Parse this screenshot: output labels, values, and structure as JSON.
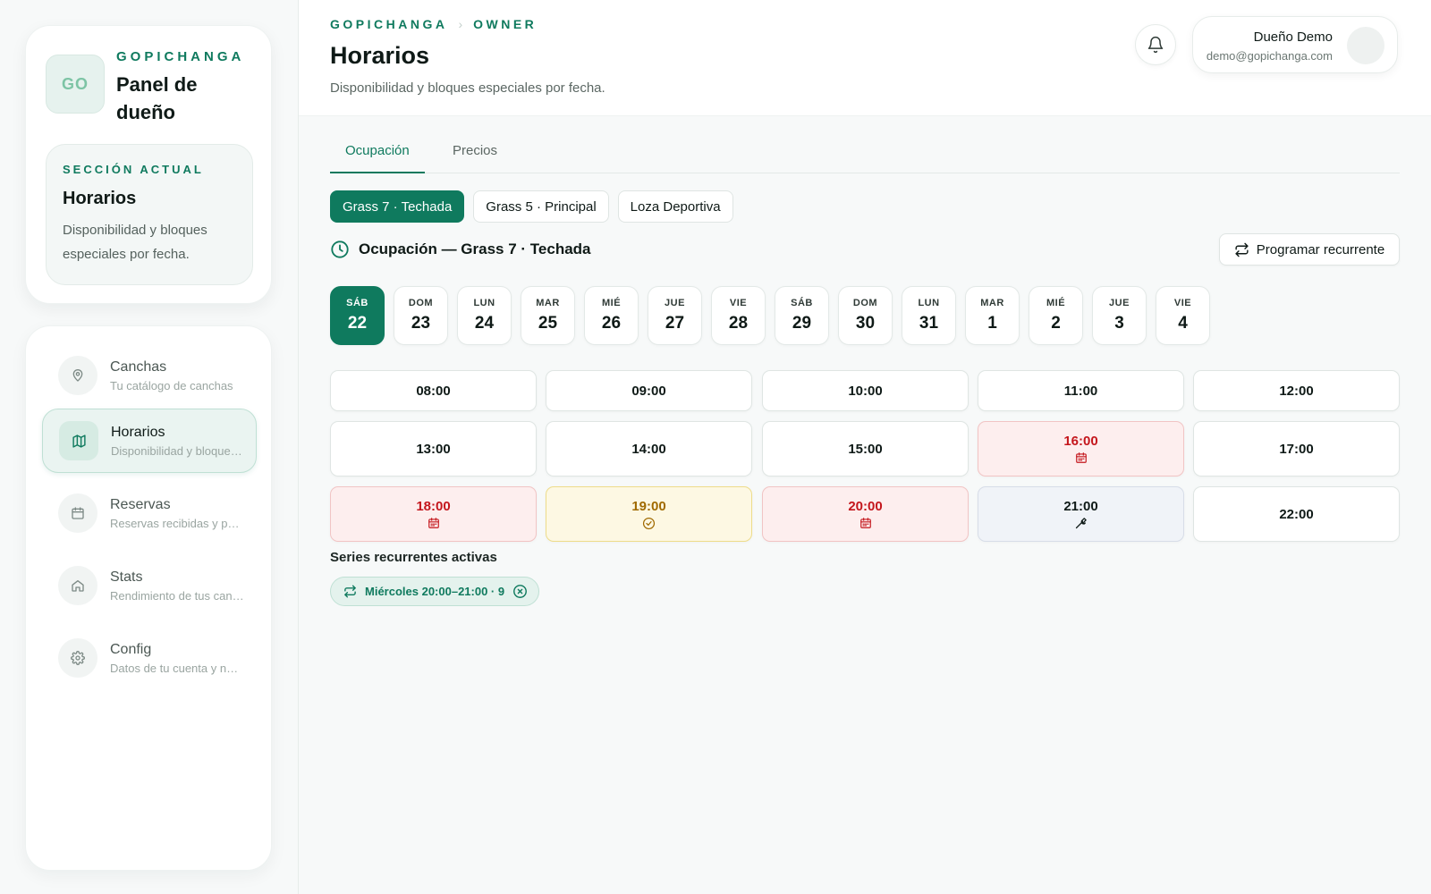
{
  "brand": {
    "logo_text": "GO",
    "eyebrow": "GOPICHANGA",
    "title": "Panel de dueño"
  },
  "current_section": {
    "eyebrow": "SECCIÓN ACTUAL",
    "title": "Horarios",
    "description": "Disponibilidad y bloques especiales por fecha."
  },
  "sidebar": {
    "items": [
      {
        "label": "Canchas",
        "sub": "Tu catálogo de canchas",
        "icon": "map-pin-icon",
        "active": false
      },
      {
        "label": "Horarios",
        "sub": "Disponibilidad y bloques especiales",
        "icon": "map-icon",
        "active": true
      },
      {
        "label": "Reservas",
        "sub": "Reservas recibidas y pendientes",
        "icon": "calendar-icon",
        "active": false
      },
      {
        "label": "Stats",
        "sub": "Rendimiento de tus canchas",
        "icon": "home-icon",
        "active": false
      },
      {
        "label": "Config",
        "sub": "Datos de tu cuenta y negocio",
        "icon": "gear-icon",
        "active": false
      }
    ]
  },
  "header": {
    "breadcrumb": [
      "GOPICHANGA",
      "OWNER"
    ],
    "title": "Horarios",
    "subtitle": "Disponibilidad y bloques especiales por fecha.",
    "user_name": "Dueño Demo",
    "user_email": "demo@gopichanga.com"
  },
  "tabs": [
    {
      "label": "Ocupación",
      "active": true
    },
    {
      "label": "Precios",
      "active": false
    }
  ],
  "fields": [
    {
      "label": "Grass 7 · Techada",
      "active": true
    },
    {
      "label": "Grass 5 · Principal",
      "active": false
    },
    {
      "label": "Loza Deportiva",
      "active": false
    }
  ],
  "occupancy": {
    "title": "Ocupación — Grass 7 · Techada",
    "recurring_button": "Programar recurrente"
  },
  "days": [
    {
      "dow": "SÁB",
      "num": "22",
      "active": true
    },
    {
      "dow": "DOM",
      "num": "23"
    },
    {
      "dow": "LUN",
      "num": "24"
    },
    {
      "dow": "MAR",
      "num": "25"
    },
    {
      "dow": "MIÉ",
      "num": "26"
    },
    {
      "dow": "JUE",
      "num": "27"
    },
    {
      "dow": "VIE",
      "num": "28"
    },
    {
      "dow": "SÁB",
      "num": "29"
    },
    {
      "dow": "DOM",
      "num": "30"
    },
    {
      "dow": "LUN",
      "num": "31"
    },
    {
      "dow": "MAR",
      "num": "1"
    },
    {
      "dow": "MIÉ",
      "num": "2"
    },
    {
      "dow": "JUE",
      "num": "3"
    },
    {
      "dow": "VIE",
      "num": "4"
    }
  ],
  "slots": [
    {
      "time": "08:00",
      "status": "free"
    },
    {
      "time": "09:00",
      "status": "free"
    },
    {
      "time": "10:00",
      "status": "free"
    },
    {
      "time": "11:00",
      "status": "free"
    },
    {
      "time": "12:00",
      "status": "free"
    },
    {
      "time": "13:00",
      "status": "free"
    },
    {
      "time": "14:00",
      "status": "free"
    },
    {
      "time": "15:00",
      "status": "free"
    },
    {
      "time": "16:00",
      "status": "booked",
      "icon": "calendar-icon"
    },
    {
      "time": "17:00",
      "status": "free"
    },
    {
      "time": "18:00",
      "status": "booked",
      "icon": "calendar-icon"
    },
    {
      "time": "19:00",
      "status": "pending",
      "icon": "check-circle-icon"
    },
    {
      "time": "20:00",
      "status": "booked",
      "icon": "calendar-icon"
    },
    {
      "time": "21:00",
      "status": "maint",
      "icon": "wrench-icon"
    },
    {
      "time": "22:00",
      "status": "free"
    }
  ],
  "series": {
    "title": "Series recurrentes activas",
    "items": [
      {
        "label": "Miércoles 20:00–21:00 · 9"
      }
    ]
  },
  "colors": {
    "brand": "#0f7a5e",
    "booked": "#c4161c",
    "pending": "#a06a00"
  }
}
